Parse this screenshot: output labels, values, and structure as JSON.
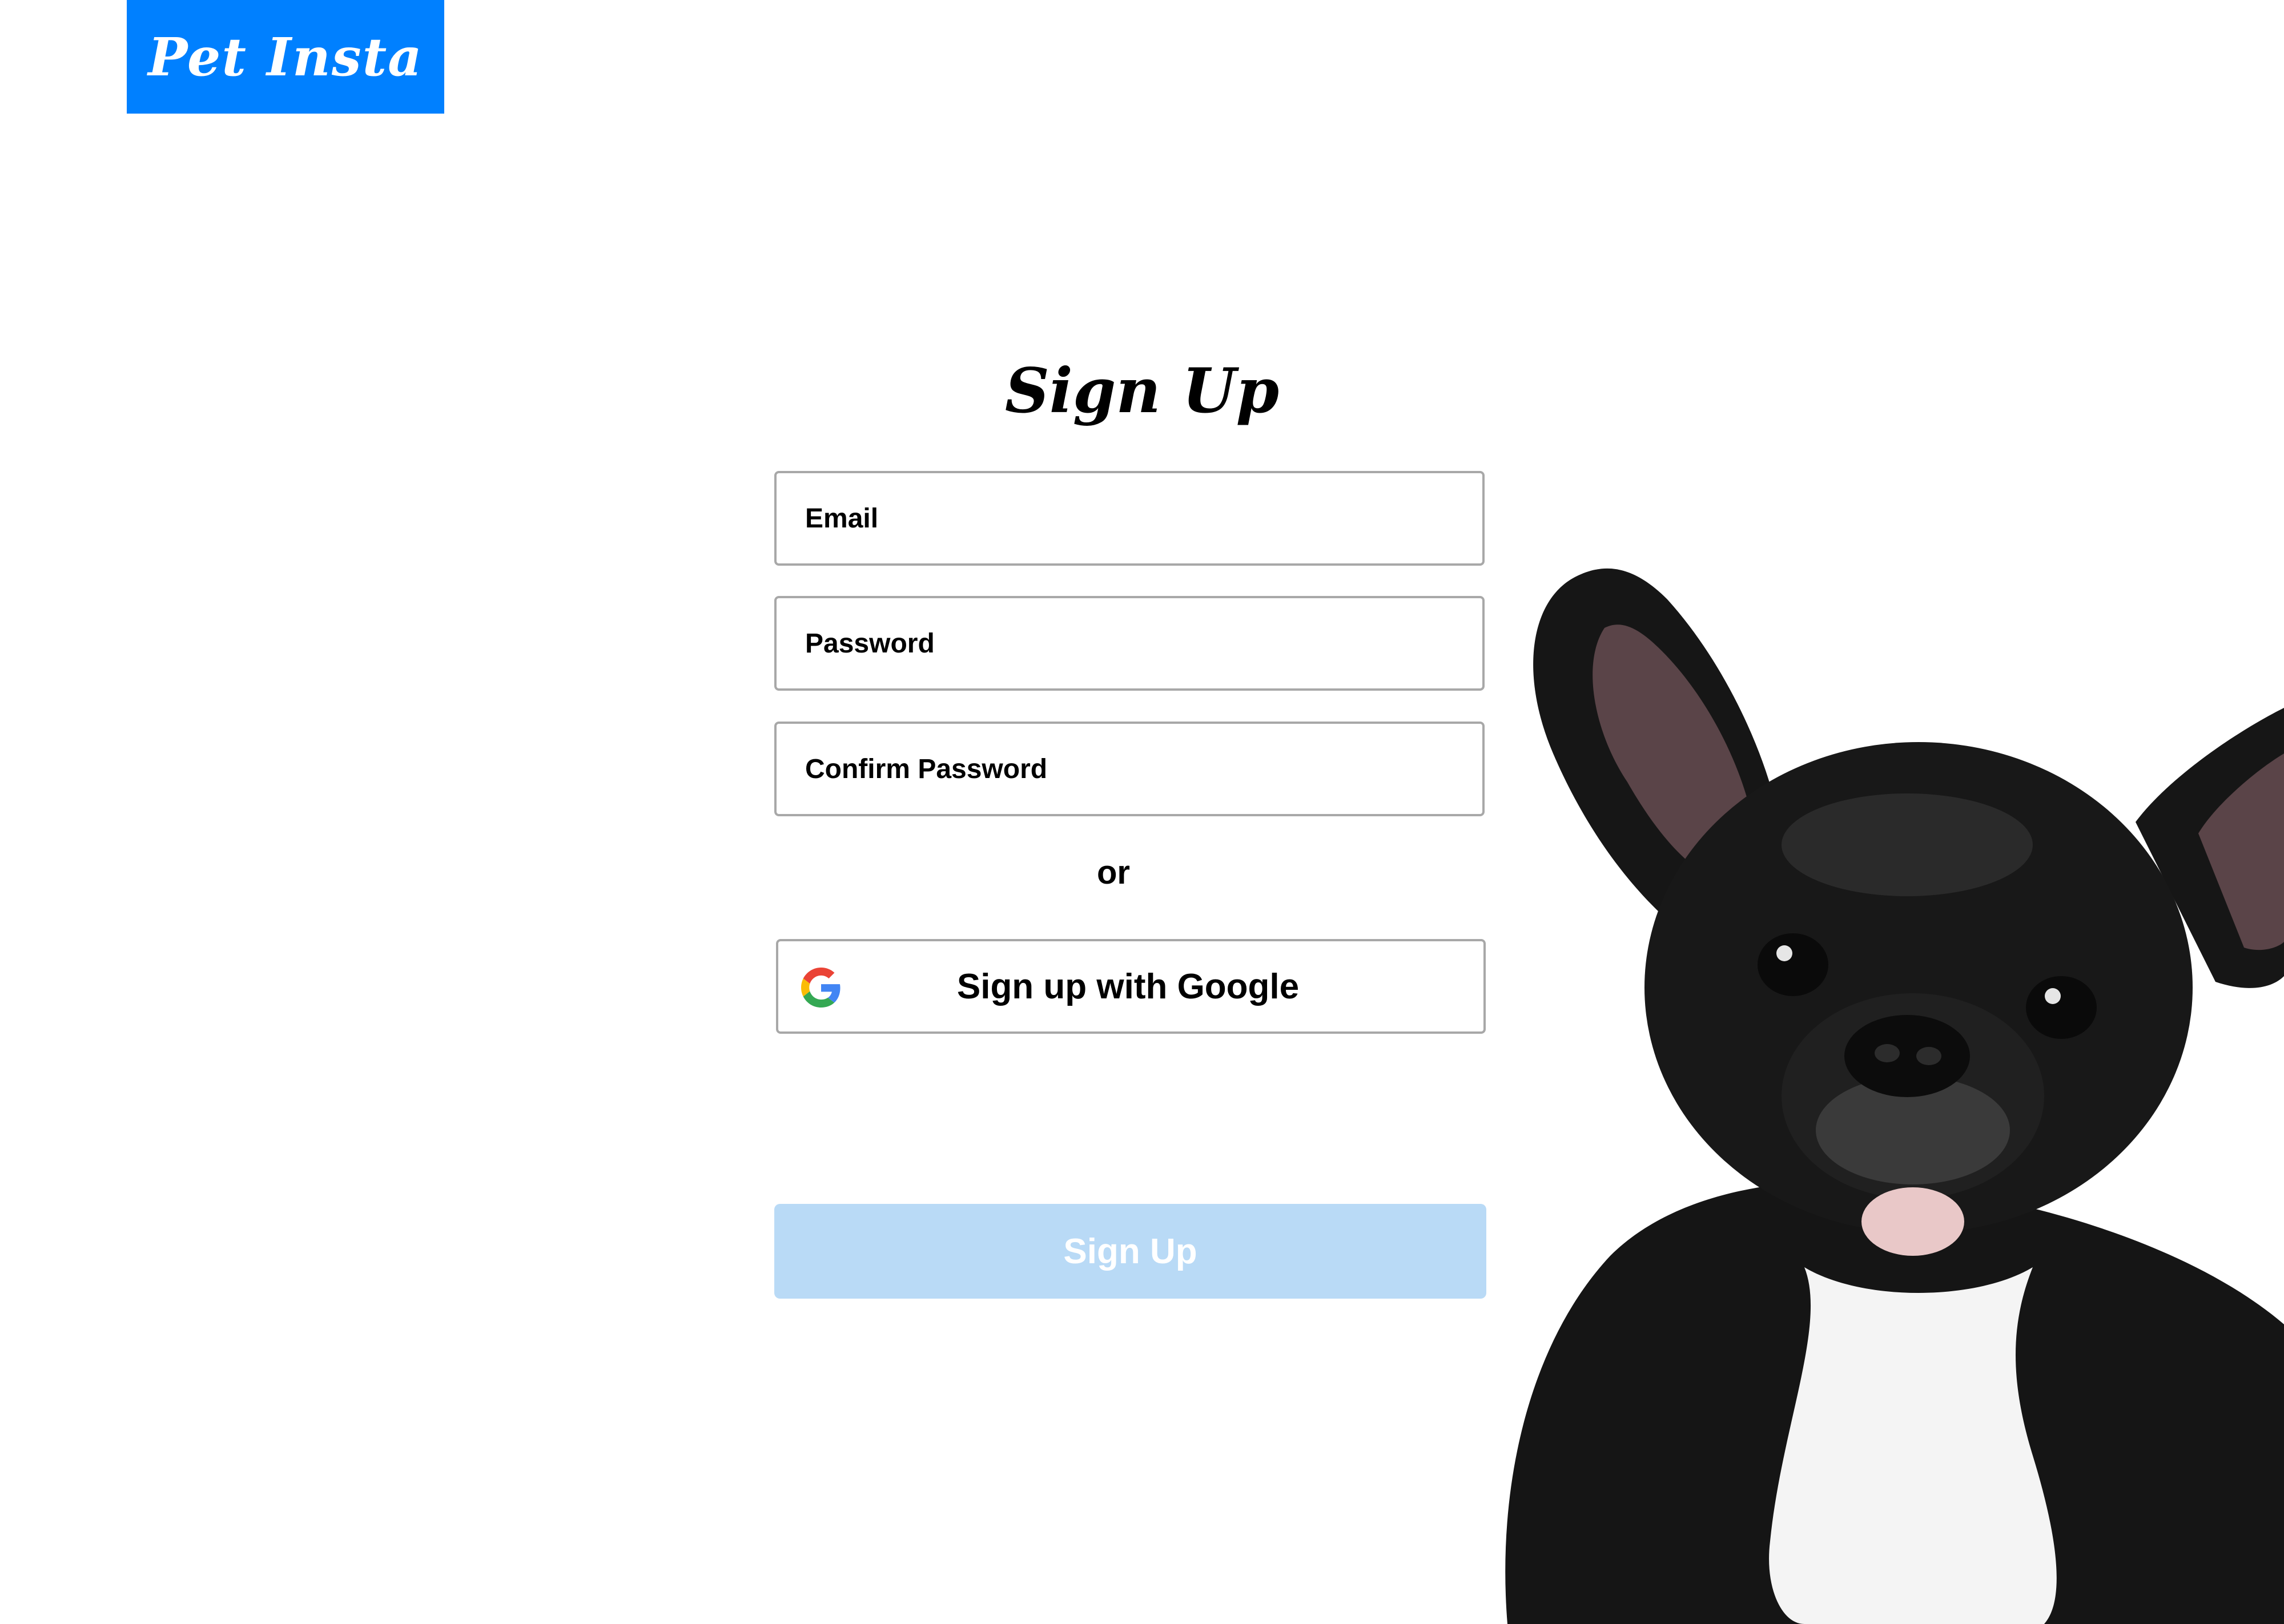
{
  "brand": {
    "logo_text": "Pet Insta",
    "color": "#0080ff"
  },
  "form": {
    "title": "Sign Up",
    "email_placeholder": "Email",
    "password_placeholder": "Password",
    "confirm_password_placeholder": "Confirm Password",
    "divider_text": "or",
    "google_button_label": "Sign up with Google",
    "submit_label": "Sign Up",
    "submit_color": "#b9daf6"
  },
  "icons": {
    "google": "google-g-icon"
  },
  "hero_image": {
    "subject": "french-bulldog-puppy"
  }
}
